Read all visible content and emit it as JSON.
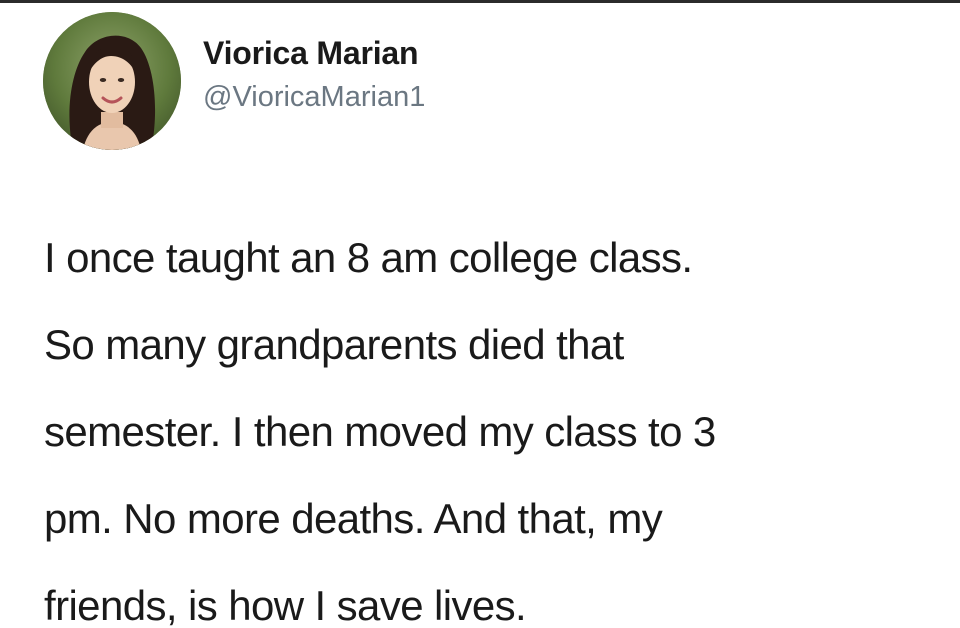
{
  "tweet": {
    "author": {
      "display_name": "Viorica Marian",
      "handle": "@VioricaMarian1",
      "avatar_icon": "profile-photo"
    },
    "text_lines": [
      "I once taught an 8 am college class.",
      "So many grandparents died that",
      "semester. I then moved my class to 3",
      "pm. No more deaths. And that, my",
      "friends, is how I save lives."
    ]
  },
  "colors": {
    "background": "#ffffff",
    "text": "#1a1a1a",
    "handle": "#6b7782"
  }
}
